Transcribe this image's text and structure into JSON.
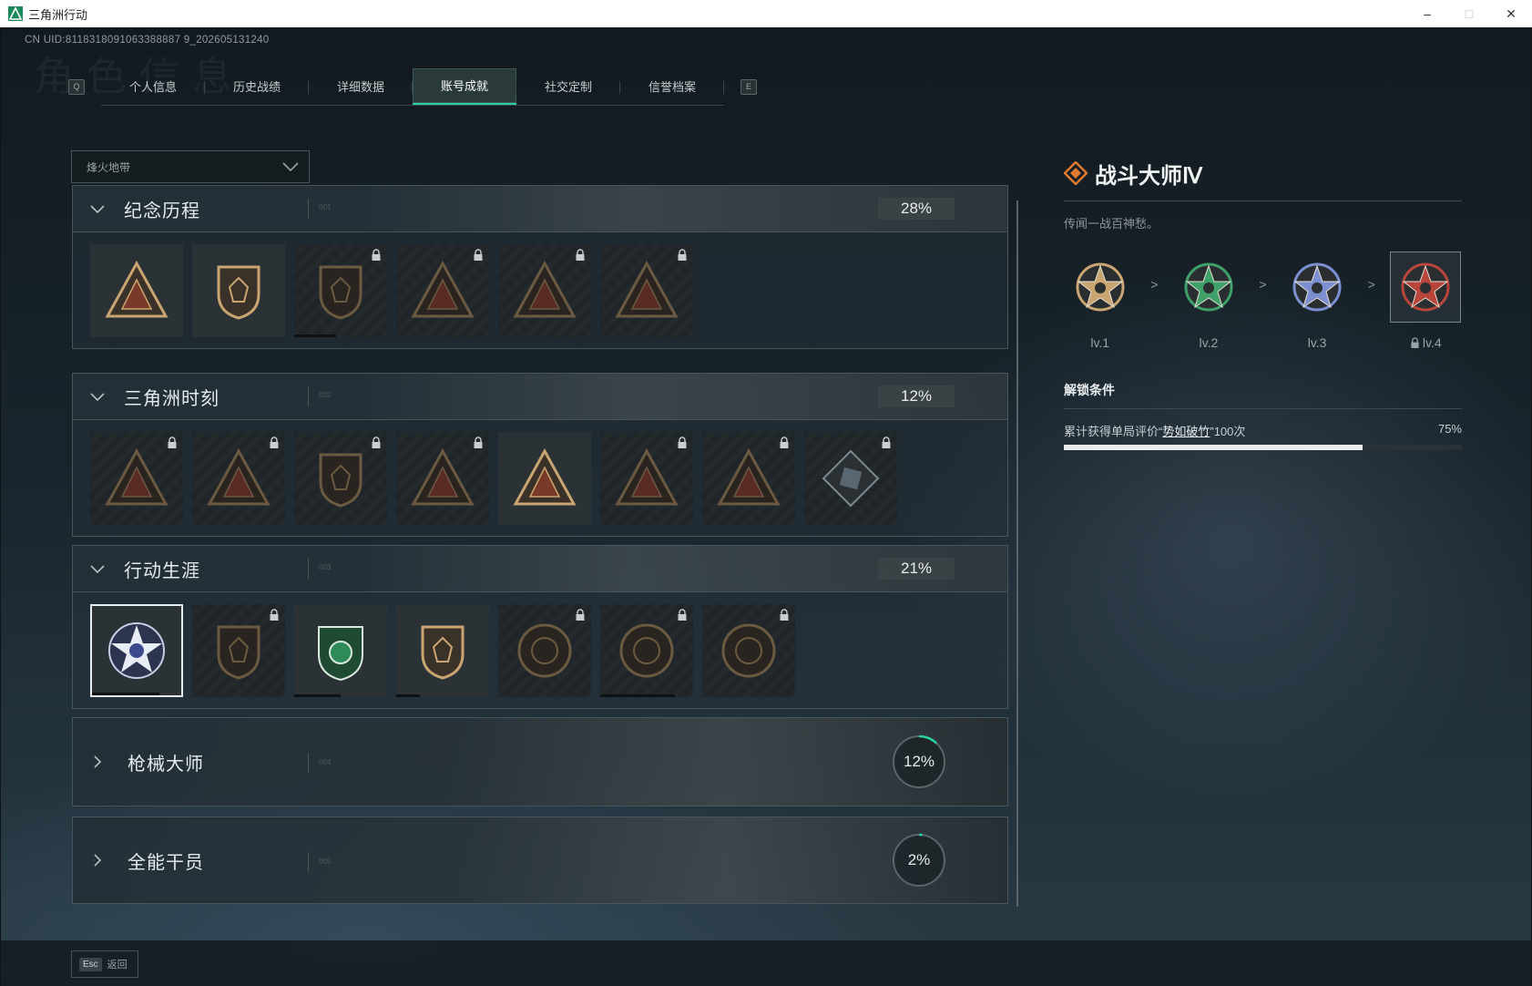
{
  "window": {
    "title": "三角洲行动",
    "controls": [
      "–",
      "□",
      "✕"
    ]
  },
  "uid_text": "CN UID:8118318091063388887 9_202605131240",
  "bg_title": "角色信息",
  "tabs": {
    "left_key": "Q",
    "right_key": "E",
    "items": [
      {
        "label": "个人信息",
        "active": false
      },
      {
        "label": "历史战绩",
        "active": false
      },
      {
        "label": "详细数据",
        "active": false
      },
      {
        "label": "账号成就",
        "active": true
      },
      {
        "label": "社交定制",
        "active": false
      },
      {
        "label": "信誉档案",
        "active": false
      }
    ]
  },
  "mode_select": {
    "value": "烽火地带"
  },
  "categories": [
    {
      "title": "纪念历程",
      "num": "001",
      "percent": "28%",
      "expanded": true,
      "badges": [
        {
          "icon": "triangle-mountain-badge",
          "locked": false,
          "progress": 0
        },
        {
          "icon": "helicopter-badge",
          "locked": false,
          "progress": 0
        },
        {
          "icon": "shield-emblem-badge",
          "locked": true,
          "progress": 0.45
        },
        {
          "icon": "winged-soldier-badge",
          "locked": true,
          "progress": 0
        },
        {
          "icon": "hooded-figure-badge",
          "locked": true,
          "progress": 0
        },
        {
          "icon": "skull-crossed-badge",
          "locked": true,
          "progress": 0
        }
      ]
    },
    {
      "title": "三角洲时刻",
      "num": "002",
      "percent": "12%",
      "expanded": true,
      "badges": [
        {
          "icon": "bag-triangle-badge",
          "locked": true
        },
        {
          "icon": "soldier-triangle-badge",
          "locked": true
        },
        {
          "icon": "sitting-figure-badge",
          "locked": true
        },
        {
          "icon": "dice-triangle-badge",
          "locked": true
        },
        {
          "icon": "squad-triangle-badge",
          "locked": false
        },
        {
          "icon": "team-winged-badge",
          "locked": true
        },
        {
          "icon": "dolphin-triangle-badge",
          "locked": true
        },
        {
          "icon": "cube-diamond-badge",
          "locked": true
        }
      ]
    },
    {
      "title": "行动生涯",
      "num": "003",
      "percent": "21%",
      "expanded": true,
      "badges": [
        {
          "icon": "star-skull-badge",
          "locked": false,
          "selected": true,
          "progress": 0.75
        },
        {
          "icon": "eagle-shield-badge",
          "locked": true,
          "progress": 0
        },
        {
          "icon": "green-star-shield-badge",
          "locked": false,
          "progress": 0.5
        },
        {
          "icon": "gem-shield-badge",
          "locked": false,
          "progress": 0.25
        },
        {
          "icon": "ring-emblem-badge",
          "locked": true,
          "progress": 0
        },
        {
          "icon": "skull-target-badge",
          "locked": true,
          "progress": 0.8
        },
        {
          "icon": "eye-emblem-badge",
          "locked": true,
          "progress": 0
        }
      ]
    },
    {
      "title": "枪械大师",
      "num": "004",
      "percent": "12%",
      "expanded": false,
      "ring": 0.12
    },
    {
      "title": "全能干员",
      "num": "005",
      "percent": "2%",
      "expanded": false,
      "ring": 0.02
    }
  ],
  "detail": {
    "title": "战斗大师Ⅳ",
    "desc": "传闻一战百神愁。",
    "levels": [
      {
        "label": "lv.1",
        "locked": false,
        "color": "#c9a571"
      },
      {
        "label": "lv.2",
        "locked": false,
        "color": "#3fa06a"
      },
      {
        "label": "lv.3",
        "locked": false,
        "color": "#7c8fd0"
      },
      {
        "label": "lv.4",
        "locked": true,
        "color": "#b8453c"
      }
    ],
    "arrow": ">",
    "cond_title": "解锁条件",
    "cond_prefix": "累计获得单局评价“",
    "cond_highlight": "势如破竹",
    "cond_suffix": "”100次",
    "cond_percent": "75%",
    "cond_progress": 0.75
  },
  "bottom": {
    "key": "Esc",
    "label": "返回"
  },
  "colors": {
    "accent": "#2ad2a0",
    "gold": "#c9a571"
  }
}
